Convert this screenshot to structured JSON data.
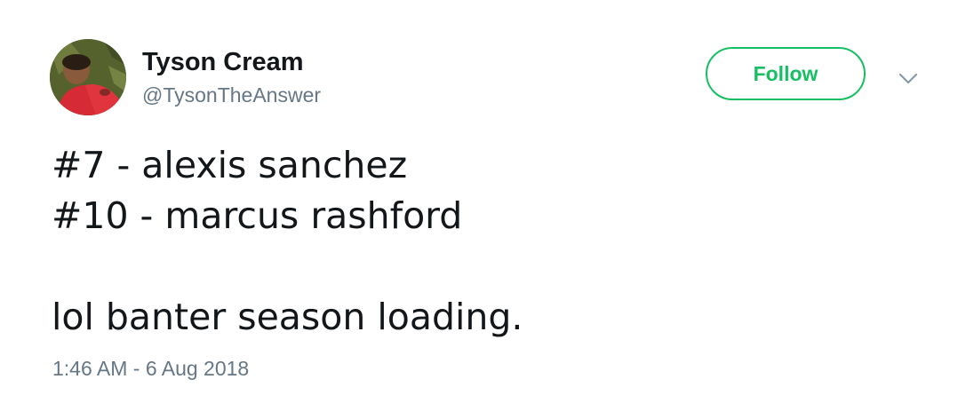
{
  "author": {
    "name": "Tyson Cream",
    "handle": "@TysonTheAnswer"
  },
  "follow_button": {
    "label": "Follow",
    "color": "#17bf63"
  },
  "menu": {
    "icon": "chevron-down-icon"
  },
  "tweet": {
    "lines": [
      "#7 - alexis sanchez",
      "#10 - marcus rashford",
      "",
      "lol banter season loading."
    ]
  },
  "timestamp": "1:46 AM - 6 Aug 2018",
  "colors": {
    "text": "#14171a",
    "secondary": "#657786",
    "accent": "#17bf63"
  }
}
